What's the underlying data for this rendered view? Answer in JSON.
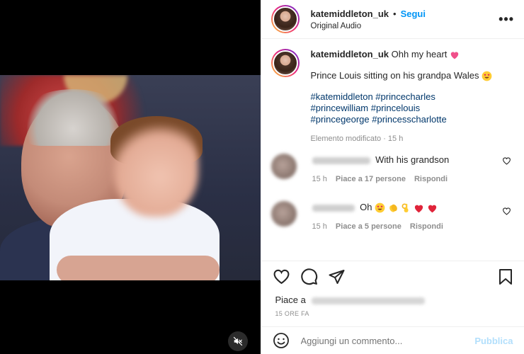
{
  "post": {
    "username": "katemiddleton_uk",
    "follow_label": "Segui",
    "dot": "•",
    "audio": "Original Audio",
    "more": "•••"
  },
  "caption": {
    "username": "katemiddleton_uk",
    "line1": "Ohh my heart",
    "line2": "Prince Louis sitting on his grandpa Wales",
    "hashtags_line1": "#katemiddleton #princecharles",
    "hashtags_line2": "#princewilliam #princelouis",
    "hashtags_line3": "#princegeorge #princesscharlotte",
    "meta": "Elemento modificato · 15 h"
  },
  "comments": [
    {
      "text": "With his grandson",
      "time": "15 h",
      "likes": "Piace a 17 persone",
      "reply": "Rispondi"
    },
    {
      "text": "Oh",
      "time": "15 h",
      "likes": "Piace a 5 persone",
      "reply": "Rispondi"
    }
  ],
  "likes_prefix": "Piace a",
  "time_ago": "15 ORE FA",
  "add_comment": {
    "placeholder": "Aggiungi un commento...",
    "publish_label": "Pubblica"
  },
  "colors": {
    "link": "#0095f6",
    "hashtag": "#00376b",
    "muted": "#8e8e8e",
    "heart": "#e0245e"
  }
}
